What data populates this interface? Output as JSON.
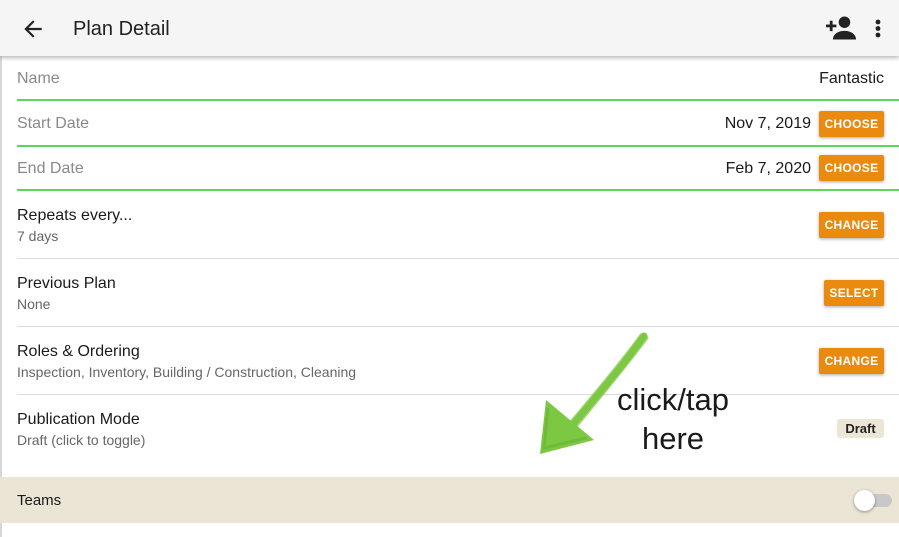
{
  "appbar": {
    "title": "Plan Detail",
    "back_icon": "arrow-left-icon",
    "add_user_icon": "person-add-icon",
    "more_icon": "more-vert-icon"
  },
  "fields": {
    "name": {
      "label": "Name",
      "value": "Fantastic"
    },
    "start_date": {
      "label": "Start Date",
      "value": "Nov 7, 2019",
      "button": "CHOOSE"
    },
    "end_date": {
      "label": "End Date",
      "value": "Feb 7, 2020",
      "button": "CHOOSE"
    }
  },
  "rows": {
    "repeats": {
      "title": "Repeats every...",
      "subtitle": "7 days",
      "button": "CHANGE"
    },
    "previous_plan": {
      "title": "Previous Plan",
      "subtitle": "None",
      "button": "SELECT"
    },
    "roles": {
      "title": "Roles & Ordering",
      "subtitle": "Inspection, Inventory, Building / Construction, Cleaning",
      "button": "CHANGE"
    },
    "publication": {
      "title": "Publication Mode",
      "subtitle": "Draft (click to toggle)",
      "chip": "Draft"
    }
  },
  "teams": {
    "label": "Teams",
    "toggle_on": false
  },
  "annotation": {
    "line1": "click/tap",
    "line2": "here"
  },
  "colors": {
    "accent_button": "#ea8b0f",
    "underline_valid": "#5cd65c",
    "teams_bg": "#ebe5d5",
    "arrow": "#7dc843"
  }
}
